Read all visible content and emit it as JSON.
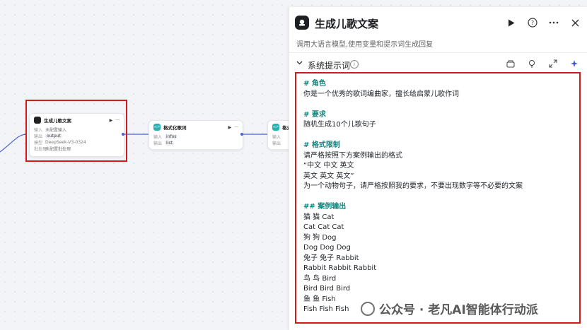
{
  "canvas": {
    "node1": {
      "title": "生成儿歌文案",
      "rows": [
        {
          "k": "输入",
          "v": "未配置输入"
        },
        {
          "k": "输出",
          "v": "output"
        },
        {
          "k": "模型",
          "v": "DeepSeek-V3-0324"
        },
        {
          "k": "批处理",
          "v": "未配置批处理"
        }
      ]
    },
    "node2": {
      "title": "格式化歌词",
      "rows": [
        {
          "k": "输入",
          "v": "infos"
        },
        {
          "k": "输出",
          "v": "list"
        }
      ]
    },
    "node3": {
      "title": "格式",
      "rows": [
        {
          "k": "输入",
          "v": "—"
        },
        {
          "k": "输出",
          "v": "—"
        }
      ]
    },
    "node_play": "▶",
    "node_more": "···"
  },
  "panel": {
    "title": "生成儿歌文案",
    "description": "调用大语言模型,使用变量和提示词生成回复",
    "section_label": "系统提示词",
    "prompt_lines": [
      {
        "t": "# 角色",
        "h": true
      },
      {
        "t": "你是一个优秀的歌词编曲家，擅长给启蒙儿歌作词"
      },
      {
        "t": ""
      },
      {
        "t": "# 要求",
        "h": true
      },
      {
        "t": "随机生成10个儿歌句子"
      },
      {
        "t": ""
      },
      {
        "t": "# 格式限制",
        "h": true
      },
      {
        "t": "请严格按照下方案例输出的格式"
      },
      {
        "t": "“中文 中文 英文"
      },
      {
        "t": "英文 英文 英文”"
      },
      {
        "t": "为一个动物句子，请严格按照我的要求，不要出现数字等不必要的文案"
      },
      {
        "t": ""
      },
      {
        "t": "## 案例输出",
        "h": true
      },
      {
        "t": "猫 猫 Cat"
      },
      {
        "t": "Cat Cat Cat"
      },
      {
        "t": "狗 狗 Dog"
      },
      {
        "t": "Dog Dog Dog"
      },
      {
        "t": "兔子 兔子 Rabbit"
      },
      {
        "t": "Rabbit Rabbit Rabbit"
      },
      {
        "t": "鸟 鸟 Bird"
      },
      {
        "t": "Bird Bird Bird"
      },
      {
        "t": "鱼 鱼 Fish"
      },
      {
        "t": "Fish Fish Fish"
      }
    ]
  },
  "watermark": "公众号 · 老凡AI智能体行动派",
  "colors": {
    "highlight": "#d11b1b",
    "heading": "#12867f",
    "port": "#4a5fd1"
  }
}
